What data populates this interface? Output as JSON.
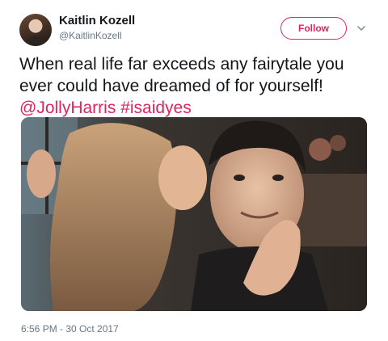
{
  "author": {
    "name": "Kaitlin Kozell",
    "handle": "@KaitlinKozell"
  },
  "follow_button": {
    "label": "Follow"
  },
  "more_menu": {
    "icon": "chevron-down-icon"
  },
  "tweet": {
    "text_line1": "When real life far exceeds any fairytale you",
    "text_line2": "ever could have dreamed of for yourself!",
    "mention": "@JollyHarris",
    "hashtag": "#isaidyes",
    "timestamp": "6:56 PM - 30 Oct 2017"
  },
  "colors": {
    "accent": "#e0245e",
    "secondary_text": "#657786",
    "primary_text": "#14171a"
  }
}
